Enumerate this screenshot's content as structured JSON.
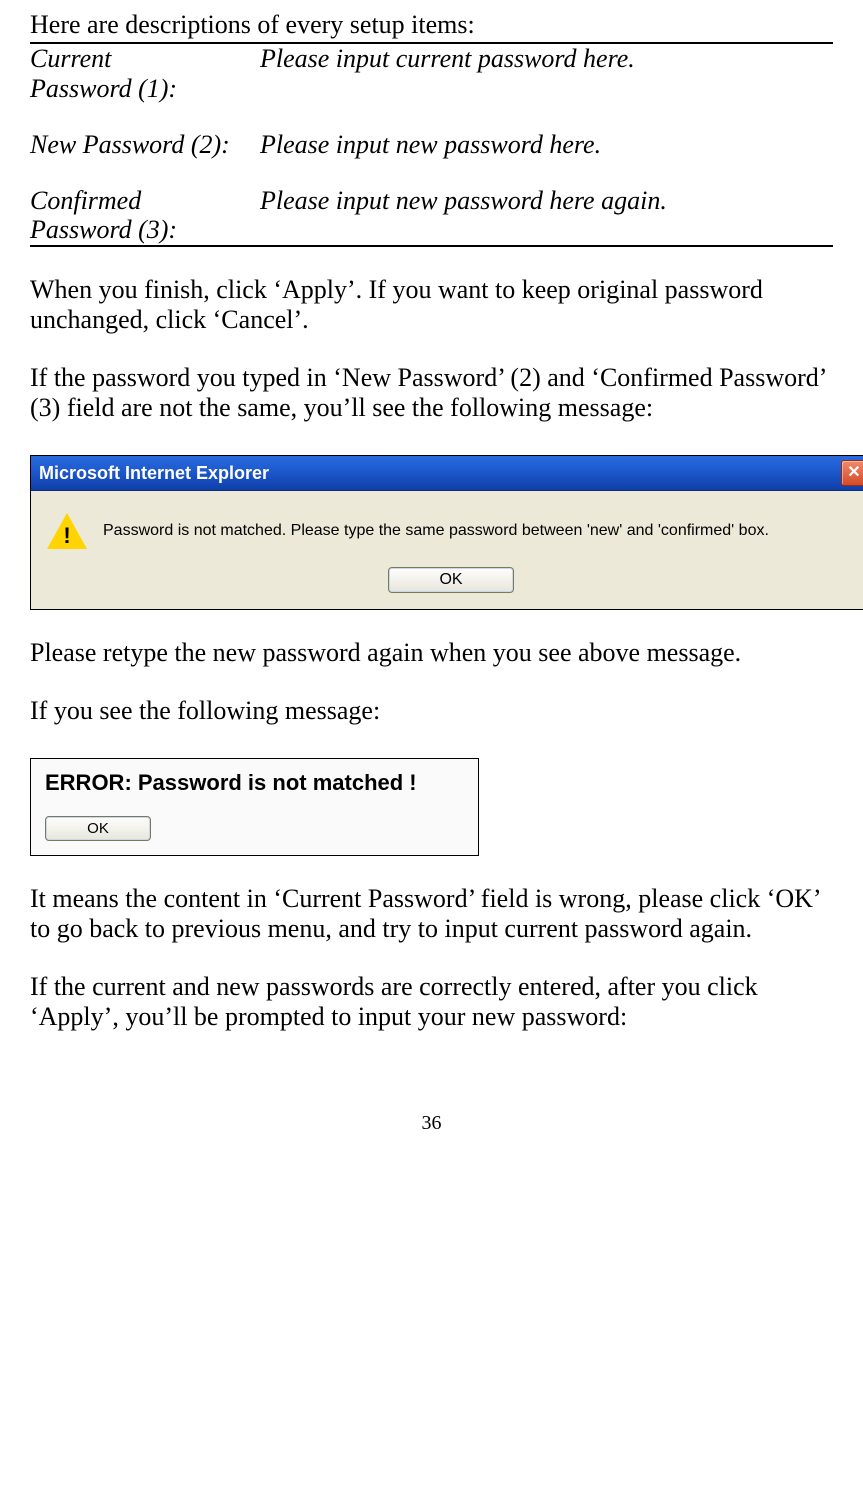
{
  "heading": "Here are descriptions of every setup items:",
  "definitions": {
    "row1_label_a": "Current",
    "row1_label_b": "Password (1):",
    "row1_desc": "Please input current password here.",
    "row2_label": "New Password (2):",
    "row2_desc": "Please input new password here.",
    "row3_label_a": "Confirmed",
    "row3_label_b": "Password (3):",
    "row3_desc": "Please input new password here again."
  },
  "para1": "When you finish, click ‘Apply’. If you want to keep original password unchanged, click ‘Cancel’.",
  "para2": "If the password you typed in ‘New Password’ (2) and ‘Confirmed Password’ (3) field are not the same, you’ll see the following message:",
  "dialog1": {
    "title": "Microsoft Internet Explorer",
    "close_glyph": "✕",
    "message": "Password is not matched. Please type the same password between 'new' and 'confirmed' box.",
    "ok_label": "OK"
  },
  "para3": "Please retype the new password again when you see above message.",
  "para4": "If you see the following message:",
  "dialog2": {
    "message": "ERROR: Password is not matched !",
    "ok_label": "OK"
  },
  "para5": "It means the content in ‘Current Password’ field is wrong, please click ‘OK’ to go back to previous menu, and try to input current password again.",
  "para6": "If the current and new passwords are correctly entered, after you click ‘Apply’, you’ll be prompted to input your new password:",
  "page_number": "36"
}
